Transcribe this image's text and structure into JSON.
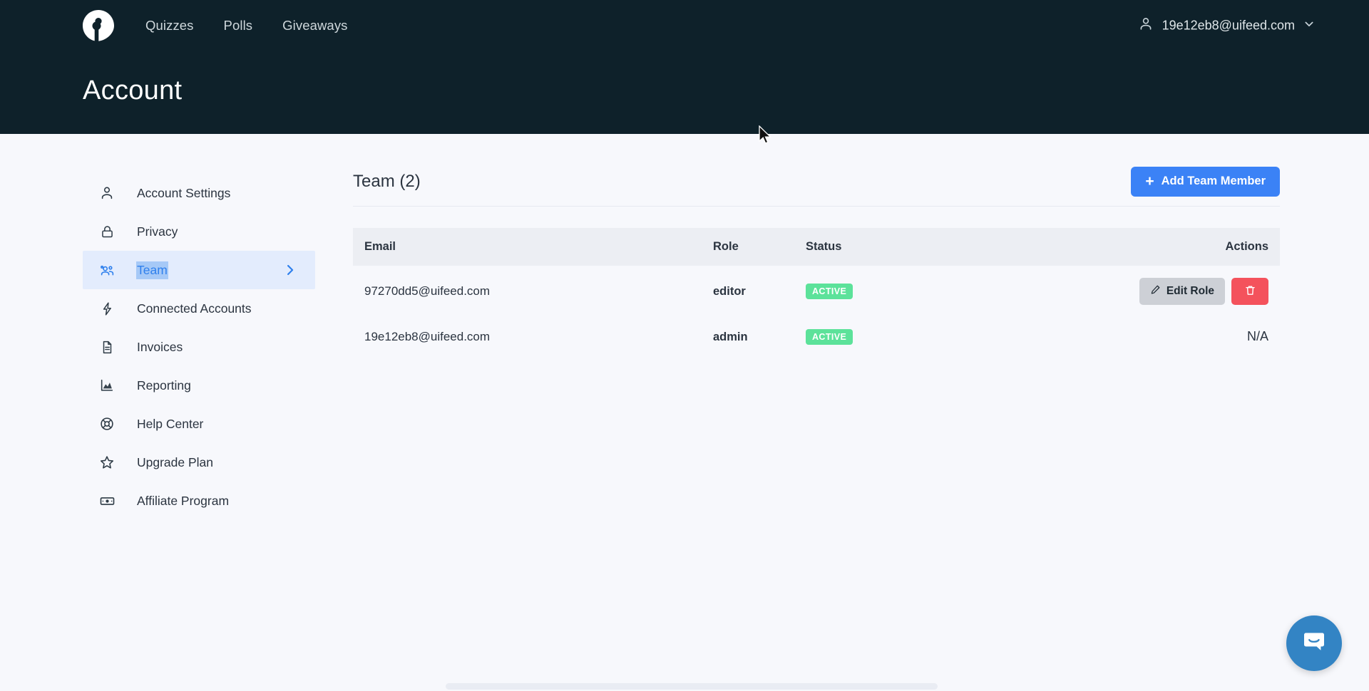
{
  "brand": {
    "logo_icon": "info-circle-logo"
  },
  "nav": {
    "links": [
      {
        "label": "Quizzes"
      },
      {
        "label": "Polls"
      },
      {
        "label": "Giveaways"
      }
    ]
  },
  "user": {
    "icon": "user-icon",
    "email": "19e12eb8@uifeed.com",
    "chevron_icon": "chevron-down-icon"
  },
  "header": {
    "title": "Account"
  },
  "sidebar": {
    "items": [
      {
        "label": "Account Settings",
        "icon": "user-icon",
        "active": false
      },
      {
        "label": "Privacy",
        "icon": "lock-icon",
        "active": false
      },
      {
        "label": "Team",
        "icon": "users-group-icon",
        "active": true
      },
      {
        "label": "Connected Accounts",
        "icon": "lightning-bolt-icon",
        "active": false
      },
      {
        "label": "Invoices",
        "icon": "document-icon",
        "active": false
      },
      {
        "label": "Reporting",
        "icon": "chart-area-icon",
        "active": false
      },
      {
        "label": "Help Center",
        "icon": "life-buoy-icon",
        "active": false
      },
      {
        "label": "Upgrade Plan",
        "icon": "star-icon",
        "active": false
      },
      {
        "label": "Affiliate Program",
        "icon": "banknote-icon",
        "active": false
      }
    ],
    "active_chevron_icon": "chevron-right-icon"
  },
  "main": {
    "title": "Team (2)",
    "add_button": {
      "label": "Add Team Member",
      "icon": "plus-icon"
    },
    "table": {
      "columns": [
        "Email",
        "Role",
        "Status",
        "Actions"
      ],
      "rows": [
        {
          "email": "97270dd5@uifeed.com",
          "role": "editor",
          "status": "ACTIVE",
          "actions_type": "buttons",
          "edit_label": "Edit Role",
          "edit_icon": "pencil-icon",
          "delete_icon": "trash-icon",
          "actions_text": ""
        },
        {
          "email": "19e12eb8@uifeed.com",
          "role": "admin",
          "status": "ACTIVE",
          "actions_type": "text",
          "edit_label": "",
          "edit_icon": "",
          "delete_icon": "",
          "actions_text": "N/A"
        }
      ]
    }
  },
  "widgets": {
    "intercom": {
      "icon": "chat-bubble-smile-icon"
    }
  },
  "colors": {
    "header_bg": "#0e212a",
    "page_bg": "#f7f8fc",
    "accent_blue": "#3b82f6",
    "active_item_bg": "#e3ecfd",
    "active_item_text": "#2f80ed",
    "selection_highlight": "#a6c9f7",
    "badge_green": "#5ce29a",
    "delete_red": "#f4525c",
    "edit_gray": "#cdd0d6",
    "table_header_bg": "#eceef3",
    "intercom_blue": "#3384c4"
  }
}
